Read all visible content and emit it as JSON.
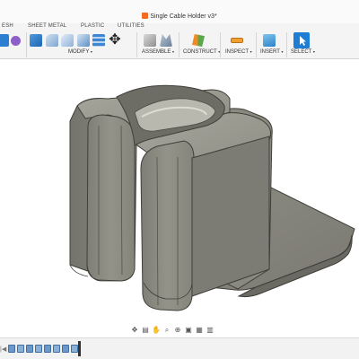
{
  "document": {
    "title": "Single Cable Holder v3*"
  },
  "ribbon": {
    "tabs": [
      "ESH",
      "SHEET METAL",
      "PLASTIC",
      "UTILITIES"
    ],
    "groups": {
      "modify": "MODIFY",
      "assemble": "ASSEMBLE",
      "construct": "CONSTRUCT",
      "inspect": "INSPECT",
      "insert": "INSERT",
      "select": "SELECT"
    },
    "dropdown_caret": "▾"
  },
  "viewport": {
    "model_color": "#8f8e85",
    "background": "#ffffff"
  },
  "nav_bar": {
    "tools": [
      "orbit-icon",
      "look-at-icon",
      "pan-icon",
      "zoom-icon",
      "zoom-window-icon",
      "display-settings-icon",
      "grid-icon",
      "viewports-icon"
    ]
  },
  "timeline": {
    "controls": [
      "|◀",
      "◀",
      "▶",
      "▶|"
    ],
    "feature_count": 8
  },
  "colors": {
    "accent_blue": "#1f7ed4",
    "accent_orange": "#f26b21",
    "ribbon_bg": "#f4f4f4"
  }
}
